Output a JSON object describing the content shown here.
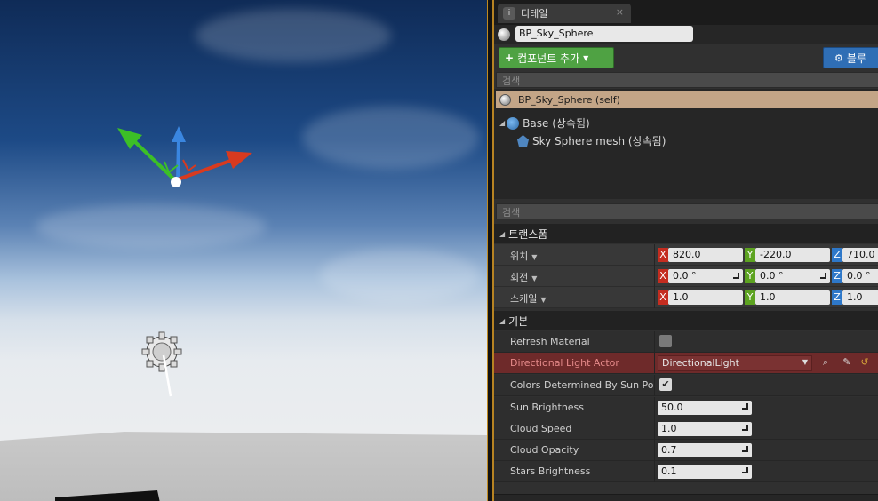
{
  "tab": {
    "icon": "details-icon",
    "label": "디테일",
    "close": "×"
  },
  "actor": {
    "name": "BP_Sky_Sphere"
  },
  "toolbar": {
    "add_component": "컴포넌트 추가",
    "blueprint": "블루"
  },
  "search1": {
    "placeholder": "검색"
  },
  "components": {
    "self": "BP_Sky_Sphere (self)",
    "base": "Base (상속됨)",
    "mesh": "Sky Sphere mesh (상속됨)"
  },
  "search2": {
    "placeholder": "검색"
  },
  "transform": {
    "header": "트랜스폼",
    "location": {
      "label": "위치",
      "x": "820.0",
      "y": "-220.0",
      "z": "710.0"
    },
    "rotation": {
      "label": "회전",
      "x": "0.0 °",
      "y": "0.0 °",
      "z": "0.0 °"
    },
    "scale": {
      "label": "스케일",
      "x": "1.0",
      "y": "1.0",
      "z": "1.0"
    },
    "axis": {
      "x": "X",
      "y": "Y",
      "z": "Z"
    }
  },
  "basic": {
    "header": "기본",
    "refresh_material": {
      "label": "Refresh Material",
      "checked": false
    },
    "directional_light_actor": {
      "label": "Directional Light Actor",
      "value": "DirectionalLight"
    },
    "colors_determined": {
      "label": "Colors Determined By Sun Position",
      "checked": true
    },
    "sun_brightness": {
      "label": "Sun Brightness",
      "value": "50.0"
    },
    "cloud_speed": {
      "label": "Cloud Speed",
      "value": "1.0"
    },
    "cloud_opacity": {
      "label": "Cloud Opacity",
      "value": "0.7"
    },
    "stars_brightness": {
      "label": "Stars Brightness",
      "value": "0.1"
    }
  },
  "colors": {
    "accent_orange": "#c08a1e",
    "green_button": "#4fa243",
    "blue_button": "#2f6eb5",
    "highlight_red": "#6e2a2a"
  }
}
